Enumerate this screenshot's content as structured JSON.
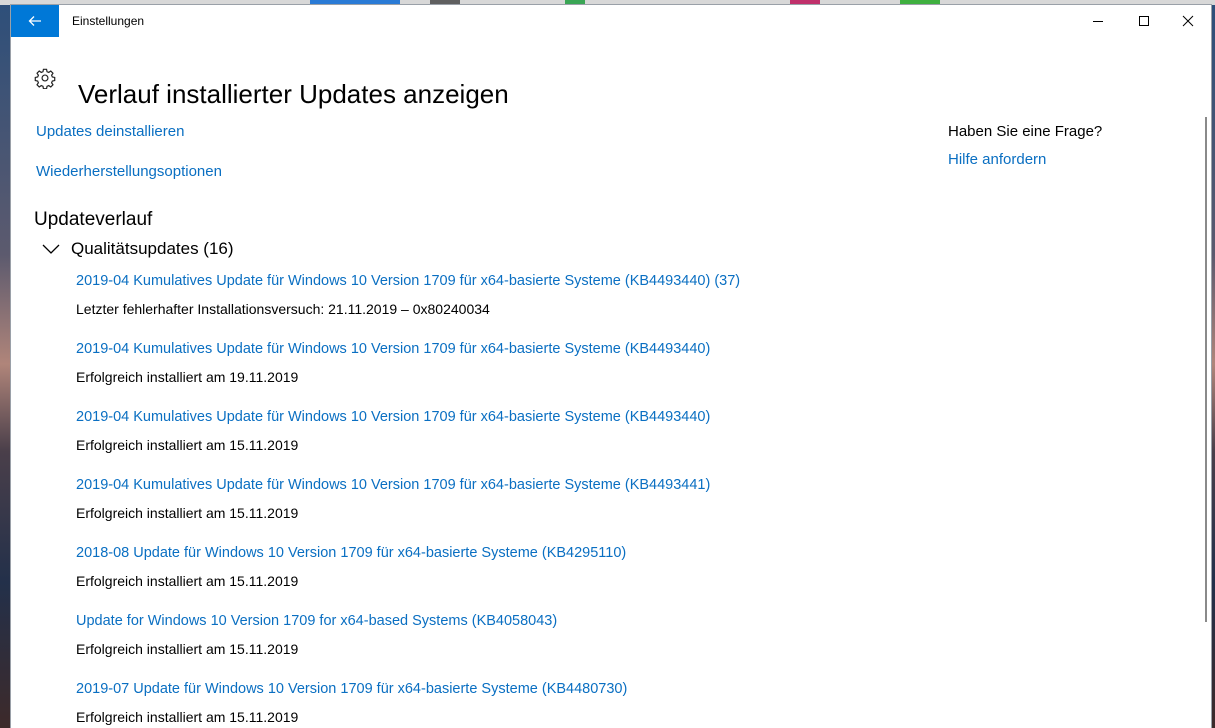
{
  "window": {
    "title": "Einstellungen",
    "back_icon": "arrow-left-icon",
    "accent": "#0078d7",
    "link_color": "#0a6fc2"
  },
  "page": {
    "title": "Verlauf installierter Updates anzeigen",
    "icon": "gear-icon"
  },
  "actions": {
    "uninstall": "Updates deinstallieren",
    "recovery": "Wiederherstellungsoptionen"
  },
  "history": {
    "heading": "Updateverlauf",
    "group_label": "Qualitätsupdates (16)",
    "items": [
      {
        "title": "2019-04 Kumulatives Update für Windows 10 Version 1709 für x64-basierte Systeme (KB4493440) (37)",
        "status": "Letzter fehlerhafter Installationsversuch: 21.11.2019 – 0x80240034"
      },
      {
        "title": "2019-04 Kumulatives Update für Windows 10 Version 1709 für x64-basierte Systeme (KB4493440)",
        "status": "Erfolgreich installiert am 19.11.2019"
      },
      {
        "title": "2019-04 Kumulatives Update für Windows 10 Version 1709 für x64-basierte Systeme (KB4493440)",
        "status": "Erfolgreich installiert am 15.11.2019"
      },
      {
        "title": "2019-04 Kumulatives Update für Windows 10 Version 1709 für x64-basierte Systeme (KB4493441)",
        "status": "Erfolgreich installiert am 15.11.2019"
      },
      {
        "title": "2018-08 Update für Windows 10 Version 1709 für x64-basierte Systeme (KB4295110)",
        "status": "Erfolgreich installiert am 15.11.2019"
      },
      {
        "title": "Update for Windows 10 Version 1709 for x64-based Systems (KB4058043)",
        "status": "Erfolgreich installiert am 15.11.2019"
      },
      {
        "title": "2019-07 Update für Windows 10 Version 1709 für x64-basierte Systeme (KB4480730)",
        "status": "Erfolgreich installiert am 15.11.2019"
      }
    ]
  },
  "sidebar": {
    "question": "Haben Sie eine Frage?",
    "help_link": "Hilfe anfordern"
  }
}
